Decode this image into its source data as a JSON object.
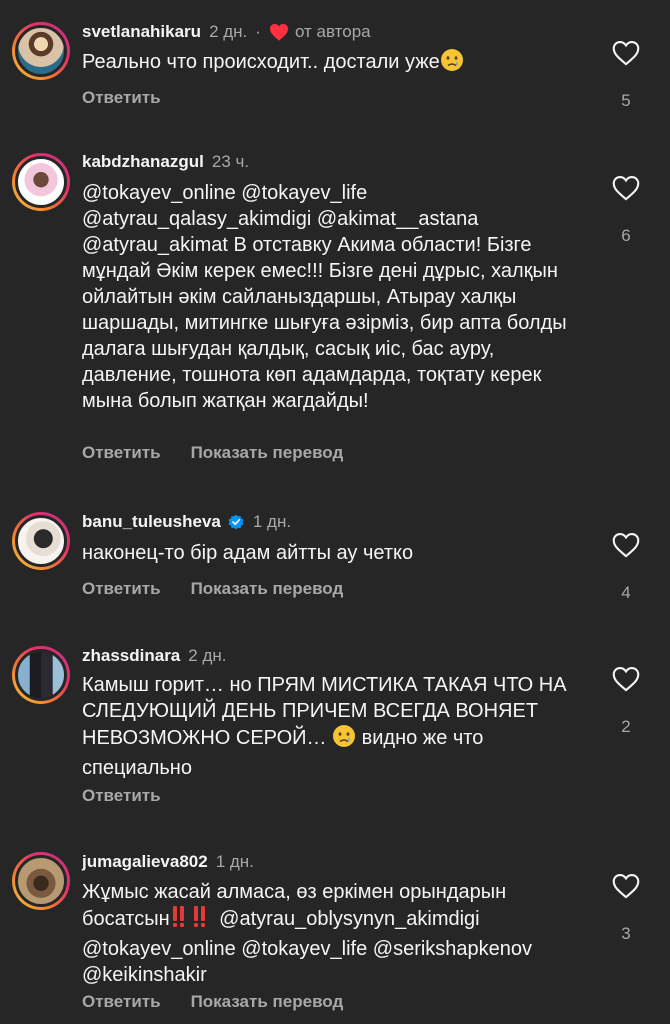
{
  "comments": [
    {
      "username": "svetlanahikaru",
      "time": "2 дн.",
      "dot": "·",
      "author_label": "от автора",
      "text": "Реально что происходит.. достали уже",
      "reply": "Ответить",
      "likes": "5"
    },
    {
      "username": "kabdzhanazgul",
      "time": "23 ч.",
      "text": "@tokayev_online @tokayev_life @atyrau_qalasy_akimdigi @akimat__astana @atyrau_akimat В отставку Акима области! Бізге мұндай Әкім керек емес!!! Бізге дені дұрыс, халқын ойлайтын әкім сайланыздаршы, Атырау халқы шаршады, митингке шығуға әзірміз, бир апта болды далага шығудан қалдық, сасық иіс, бас ауру, давление, тошнота көп адамдарда, тоқтату керек мына болып жатқан жагдайды!",
      "reply": "Ответить",
      "translate": "Показать перевод",
      "likes": "6"
    },
    {
      "username": "banu_tuleusheva",
      "time": "1 дн.",
      "text": "наконец-то бір адам айтты ау четко",
      "reply": "Ответить",
      "translate": "Показать перевод",
      "likes": "4"
    },
    {
      "username": "zhassdinara",
      "time": "2 дн.",
      "text_before": "Камыш горит… но ПРЯМ МИСТИКА ТАКАЯ ЧТО НА СЛЕДУЮЩИЙ ДЕНЬ ПРИЧЕМ ВСЕГДА ВОНЯЕТ НЕВОЗМОЖНО СЕРОЙ… ",
      "text_after": " видно же что специально",
      "reply": "Ответить",
      "likes": "2"
    },
    {
      "username": "jumagalieva802",
      "time": "1 дн.",
      "text_before": "Жұмыс жасай алмаса, өз еркімен орындарын босатсын",
      "text_after": " @atyrau_oblysynyn_akimdigi @tokayev_online @tokayev_life @serikshapkenov @keikinshakir",
      "reply": "Ответить",
      "translate": "Показать перевод",
      "likes": "3"
    }
  ],
  "icons": {
    "like": "heart-outline-icon",
    "author_like": "heart-filled-icon",
    "verified": "verified-badge-icon",
    "crying": "crying-face-emoji",
    "exclamation": "double-exclamation-emoji"
  },
  "colors": {
    "background": "#262626",
    "text": "#f5f5f5",
    "secondary": "#a8a8a8",
    "author_heart": "#ff3040",
    "verified": "#0095f6"
  }
}
